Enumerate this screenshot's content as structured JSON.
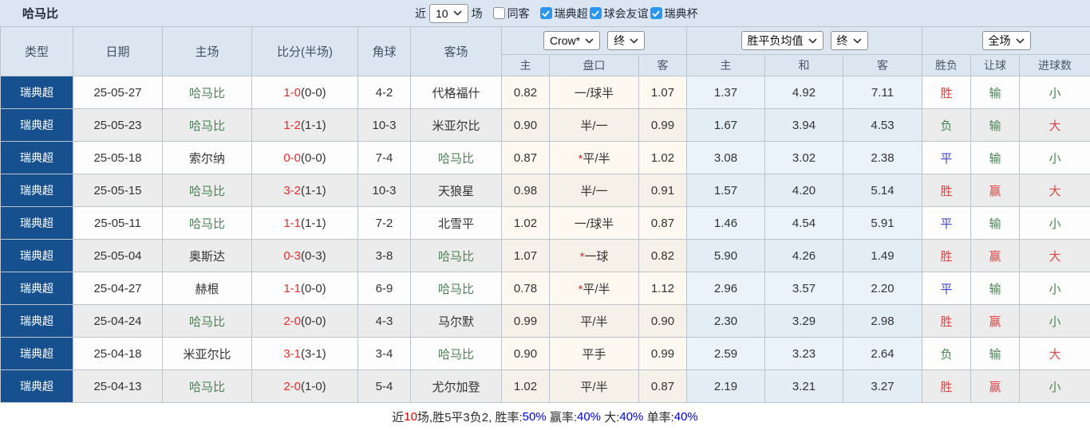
{
  "title": "哈马比",
  "toolbar": {
    "recent_label": "近",
    "recent_count": "10",
    "matches_label": "场",
    "same_venue": {
      "label": "同客",
      "checked": false
    },
    "leagues": [
      {
        "label": "瑞典超",
        "checked": true
      },
      {
        "label": "球会友谊",
        "checked": true
      },
      {
        "label": "瑞典杯",
        "checked": true
      }
    ]
  },
  "table": {
    "headers": {
      "type": "类型",
      "date": "日期",
      "home": "主场",
      "score": "比分(半场)",
      "corner": "角球",
      "away": "客场",
      "asian_home": "主",
      "handicap": "盘口",
      "asian_away": "客",
      "euro_win": "主",
      "euro_draw": "和",
      "euro_lose": "客",
      "result": "胜负",
      "handicap_result": "让球",
      "goals": "进球数"
    },
    "selects": {
      "bookmaker": "Crow*",
      "asian_time": "终",
      "avg": "胜平负均值",
      "euro_time": "终",
      "scope": "全场"
    },
    "rows": [
      {
        "type": "瑞典超",
        "date": "25-05-27",
        "home": "哈马比",
        "home_color": "green",
        "score": "1-0",
        "half": "(0-0)",
        "corner": "4-2",
        "away": "代格福什",
        "away_color": "",
        "asian_home": "0.82",
        "handicap_star": "",
        "handicap": "一/球半",
        "asian_away": "1.07",
        "euro_win": "1.37",
        "euro_draw": "4.92",
        "euro_lose": "7.11",
        "result": "胜",
        "result_color": "red",
        "handicap_result": "输",
        "handicap_result_color": "green",
        "goals": "小",
        "goals_color": "green"
      },
      {
        "type": "瑞典超",
        "date": "25-05-23",
        "home": "哈马比",
        "home_color": "green",
        "score": "1-2",
        "half": "(1-1)",
        "corner": "10-3",
        "away": "米亚尔比",
        "away_color": "",
        "asian_home": "0.90",
        "handicap_star": "",
        "handicap": "半/一",
        "asian_away": "0.99",
        "euro_win": "1.67",
        "euro_draw": "3.94",
        "euro_lose": "4.53",
        "result": "负",
        "result_color": "green",
        "handicap_result": "输",
        "handicap_result_color": "green",
        "goals": "大",
        "goals_color": "red"
      },
      {
        "type": "瑞典超",
        "date": "25-05-18",
        "home": "索尔纳",
        "home_color": "",
        "score": "0-0",
        "half": "(0-0)",
        "corner": "7-4",
        "away": "哈马比",
        "away_color": "green",
        "asian_home": "0.87",
        "handicap_star": "*",
        "handicap": "平/半",
        "asian_away": "1.02",
        "euro_win": "3.08",
        "euro_draw": "3.02",
        "euro_lose": "2.38",
        "result": "平",
        "result_color": "blue",
        "handicap_result": "输",
        "handicap_result_color": "green",
        "goals": "小",
        "goals_color": "green"
      },
      {
        "type": "瑞典超",
        "date": "25-05-15",
        "home": "哈马比",
        "home_color": "green",
        "score": "3-2",
        "half": "(1-1)",
        "corner": "10-3",
        "away": "天狼星",
        "away_color": "",
        "asian_home": "0.98",
        "handicap_star": "",
        "handicap": "半/一",
        "asian_away": "0.91",
        "euro_win": "1.57",
        "euro_draw": "4.20",
        "euro_lose": "5.14",
        "result": "胜",
        "result_color": "red",
        "handicap_result": "赢",
        "handicap_result_color": "red",
        "goals": "大",
        "goals_color": "red"
      },
      {
        "type": "瑞典超",
        "date": "25-05-11",
        "home": "哈马比",
        "home_color": "green",
        "score": "1-1",
        "half": "(1-1)",
        "corner": "7-2",
        "away": "北雪平",
        "away_color": "",
        "asian_home": "1.02",
        "handicap_star": "",
        "handicap": "一/球半",
        "asian_away": "0.87",
        "euro_win": "1.46",
        "euro_draw": "4.54",
        "euro_lose": "5.91",
        "result": "平",
        "result_color": "blue",
        "handicap_result": "输",
        "handicap_result_color": "green",
        "goals": "小",
        "goals_color": "green"
      },
      {
        "type": "瑞典超",
        "date": "25-05-04",
        "home": "奥斯达",
        "home_color": "",
        "score": "0-3",
        "half": "(0-3)",
        "corner": "3-8",
        "away": "哈马比",
        "away_color": "green",
        "asian_home": "1.07",
        "handicap_star": "*",
        "handicap": "一球",
        "asian_away": "0.82",
        "euro_win": "5.90",
        "euro_draw": "4.26",
        "euro_lose": "1.49",
        "result": "胜",
        "result_color": "red",
        "handicap_result": "赢",
        "handicap_result_color": "red",
        "goals": "大",
        "goals_color": "red"
      },
      {
        "type": "瑞典超",
        "date": "25-04-27",
        "home": "赫根",
        "home_color": "",
        "score": "1-1",
        "half": "(0-0)",
        "corner": "6-9",
        "away": "哈马比",
        "away_color": "green",
        "asian_home": "0.78",
        "handicap_star": "*",
        "handicap": "平/半",
        "asian_away": "1.12",
        "euro_win": "2.96",
        "euro_draw": "3.57",
        "euro_lose": "2.20",
        "result": "平",
        "result_color": "blue",
        "handicap_result": "输",
        "handicap_result_color": "green",
        "goals": "小",
        "goals_color": "green"
      },
      {
        "type": "瑞典超",
        "date": "25-04-24",
        "home": "哈马比",
        "home_color": "green",
        "score": "2-0",
        "half": "(0-0)",
        "corner": "4-3",
        "away": "马尔默",
        "away_color": "",
        "asian_home": "0.99",
        "handicap_star": "",
        "handicap": "平/半",
        "asian_away": "0.90",
        "euro_win": "2.30",
        "euro_draw": "3.29",
        "euro_lose": "2.98",
        "result": "胜",
        "result_color": "red",
        "handicap_result": "赢",
        "handicap_result_color": "red",
        "goals": "小",
        "goals_color": "green"
      },
      {
        "type": "瑞典超",
        "date": "25-04-18",
        "home": "米亚尔比",
        "home_color": "",
        "score": "3-1",
        "half": "(3-1)",
        "corner": "3-4",
        "away": "哈马比",
        "away_color": "green",
        "asian_home": "0.90",
        "handicap_star": "",
        "handicap": "平手",
        "asian_away": "0.99",
        "euro_win": "2.59",
        "euro_draw": "3.23",
        "euro_lose": "2.64",
        "result": "负",
        "result_color": "green",
        "handicap_result": "输",
        "handicap_result_color": "green",
        "goals": "大",
        "goals_color": "red"
      },
      {
        "type": "瑞典超",
        "date": "25-04-13",
        "home": "哈马比",
        "home_color": "green",
        "score": "2-0",
        "half": "(1-0)",
        "corner": "5-4",
        "away": "尤尔加登",
        "away_color": "",
        "asian_home": "1.02",
        "handicap_star": "",
        "handicap": "平/半",
        "asian_away": "0.87",
        "euro_win": "2.19",
        "euro_draw": "3.21",
        "euro_lose": "3.27",
        "result": "胜",
        "result_color": "red",
        "handicap_result": "赢",
        "handicap_result_color": "red",
        "goals": "小",
        "goals_color": "green"
      }
    ]
  },
  "summary": {
    "seg1": "近",
    "seg2": "10",
    "seg3": "场,胜5平3负2, 胜率:",
    "seg4": "50%",
    "seg5": " 赢率:",
    "seg6": "40%",
    "seg7": " 大:",
    "seg8": "40%",
    "seg9": " 单率:",
    "seg10": "40%"
  },
  "colors": {
    "type_cell_navy": "#17508f",
    "header_bg": "#dce6f1",
    "asian_odds_bg": "#fdf8f0",
    "euro_odds_bg": "#eaf3fa",
    "win_red": "#e04545",
    "team_green": "#4a8454",
    "draw_blue": "#4343cf",
    "score_red": "#e52b2b",
    "percent_blue": "#0000dd",
    "checkbox_blue": "#2b97ef"
  }
}
